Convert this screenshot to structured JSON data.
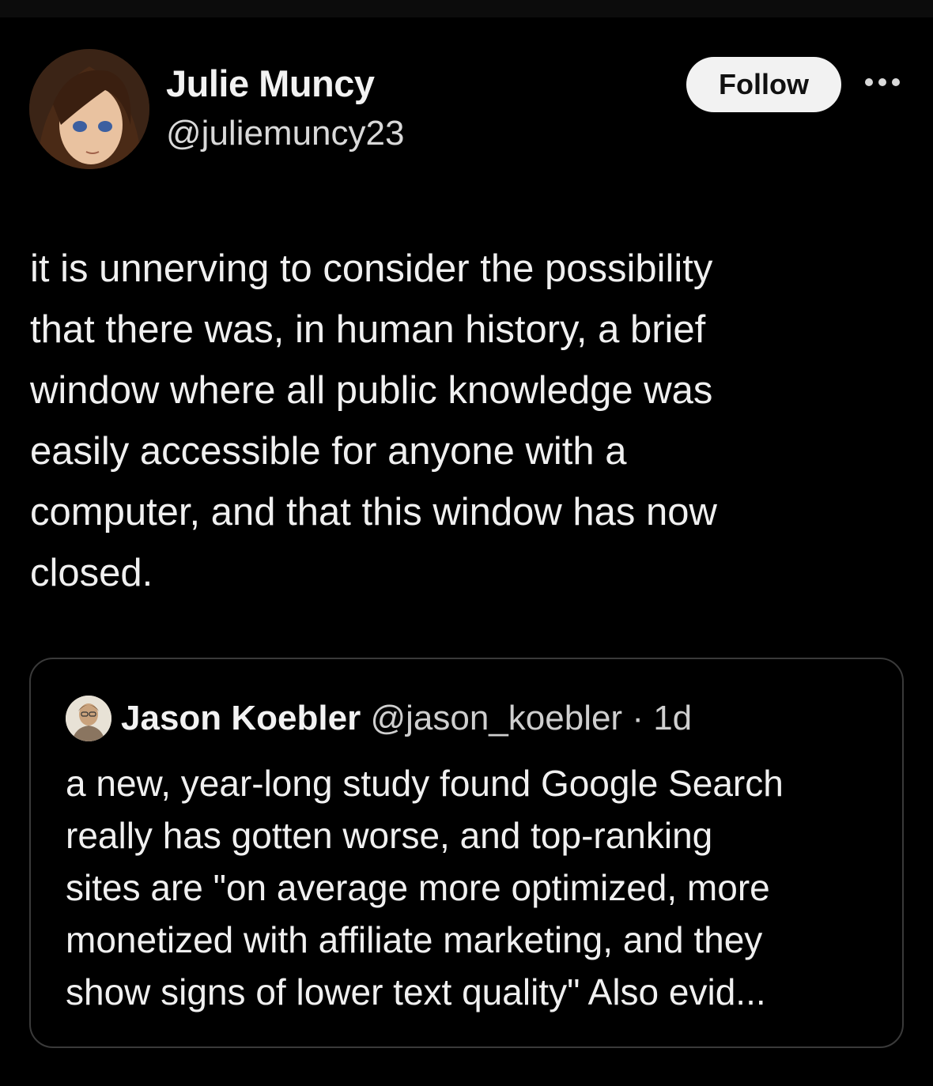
{
  "tweet": {
    "author": {
      "name": "Julie Muncy",
      "handle": "@juliemuncy23"
    },
    "follow_label": "Follow",
    "more_label": "•••",
    "text": "it is unnerving to consider the possibility\nthat there was, in human history, a brief\nwindow where all public knowledge was\neasily accessible for anyone with a\ncomputer, and that this window has now\nclosed."
  },
  "quote": {
    "author": {
      "name": "Jason Koebler",
      "handle": "@jason_koebler",
      "separator": "·",
      "time": "1d"
    },
    "text": "a new, year-long study found Google Search\nreally has gotten worse, and top-ranking\nsites are \"on average more optimized, more\nmonetized with affiliate marketing, and they\nshow signs of lower text quality\" Also evid..."
  },
  "colors": {
    "background": "#000000",
    "text": "#f0f0f0",
    "follow_button": "#f2f2f2",
    "card_border": "#3a3a3a"
  },
  "icons": {
    "more": "more-horizontal-icon"
  }
}
